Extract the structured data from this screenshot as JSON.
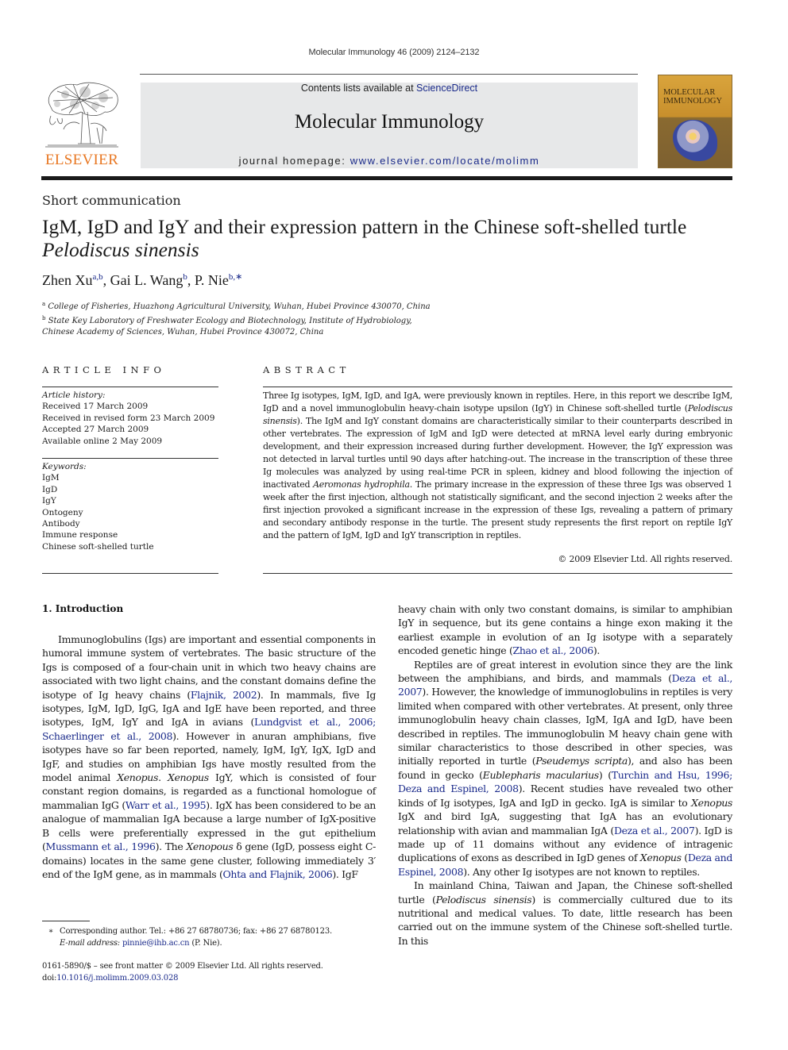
{
  "running_head": "Molecular Immunology 46 (2009) 2124–2132",
  "masthead": {
    "contents_prefix": "Contents lists available at ",
    "contents_link": "ScienceDirect",
    "journal_name": "Molecular Immunology",
    "homepage_prefix": "journal homepage: ",
    "homepage_link": "www.elsevier.com/locate/molimm",
    "publisher_logo_text": "ELSEVIER",
    "cover_title_line1": "MOLECULAR",
    "cover_title_line2": "IMMUNOLOGY",
    "colors": {
      "publisher_orange": "#e87722",
      "link_blue": "#1a2a8a",
      "masthead_bg": "#e7e8e9"
    }
  },
  "article": {
    "type": "Short communication",
    "title_main": "IgM, IgD and IgY and their expression pattern in the Chinese soft-shelled turtle",
    "title_species": "Pelodiscus sinensis",
    "authors": [
      {
        "name": "Zhen Xu",
        "sup": "a,b",
        "sep": ", "
      },
      {
        "name": "Gai L. Wang",
        "sup": "b",
        "sep": ", "
      },
      {
        "name": "P. Nie",
        "sup": "b,∗",
        "sep": ""
      }
    ],
    "affiliations": [
      {
        "mark": "a",
        "text": "College of Fisheries, Huazhong Agricultural University, Wuhan, Hubei Province 430070, China"
      },
      {
        "mark": "b",
        "text": "State Key Laboratory of Freshwater Ecology and Biotechnology, Institute of Hydrobiology,",
        "cont": "Chinese Academy of Sciences, Wuhan, Hubei Province 430072, China"
      }
    ]
  },
  "article_info": {
    "heading": "ARTICLE INFO",
    "history_label": "Article history:",
    "history": [
      "Received 17 March 2009",
      "Received in revised form 23 March 2009",
      "Accepted 27 March 2009",
      "Available online 2 May 2009"
    ],
    "keywords_label": "Keywords:",
    "keywords": [
      "IgM",
      "IgD",
      "IgY",
      "Ontogeny",
      "Antibody",
      "Immune response",
      "Chinese soft-shelled turtle"
    ]
  },
  "abstract": {
    "heading": "ABSTRACT",
    "p1": "Three Ig isotypes, IgM, IgD, and IgA, were previously known in reptiles. Here, in this report we describe IgM, IgD and a novel immunoglobulin heavy-chain isotype upsilon (IgY) in Chinese soft-shelled turtle (",
    "p1_species": "Pelodiscus sinensis",
    "p2": "). The IgM and IgY constant domains are characteristically similar to their counterparts described in other vertebrates. The expression of IgM and IgD were detected at mRNA level early during embryonic development, and their expression increased during further development. However, the IgY expression was not detected in larval turtles until 90 days after hatching-out. The increase in the transcription of these three Ig molecules was analyzed by using real-time PCR in spleen, kidney and blood following the injection of inactivated ",
    "p2_species": "Aeromonas hydrophila",
    "p3": ". The primary increase in the expression of these three Igs was observed 1 week after the first injection, although not statistically significant, and the second injection 2 weeks after the first injection provoked a significant increase in the expression of these Igs, revealing a pattern of primary and secondary antibody response in the turtle. The present study represents the first report on reptile IgY and the pattern of IgM, IgD and IgY transcription in reptiles.",
    "copyright": "© 2009 Elsevier Ltd. All rights reserved."
  },
  "intro": {
    "heading": "1.  Introduction",
    "left": {
      "t1": "Immunoglobulins (Igs) are important and essential components in humoral immune system of vertebrates. The basic structure of the Igs is composed of a four-chain unit in which two heavy chains are associated with two light chains, and the constant domains define the isotype of Ig heavy chains (",
      "r1": "Flajnik, 2002",
      "t2": "). In mammals, five Ig isotypes, IgM, IgD, IgG, IgA and IgE have been reported, and three isotypes, IgM, IgY and IgA in avians (",
      "r2": "Lundgvist et al., 2006; Schaerlinger et al., 2008",
      "t3": "). However in anuran amphibians, five isotypes have so far been reported, namely, IgM, IgY, IgX, IgD and IgF, and studies on amphibian Igs have mostly resulted from the model animal ",
      "i1": "Xenopus",
      "t4": ". ",
      "i2": "Xenopus",
      "t5": " IgY, which is consisted of four constant region domains, is regarded as a functional homologue of mammalian IgG (",
      "r3": "Warr et al., 1995",
      "t6": "). IgX has been considered to be an analogue of mammalian IgA because a large number of IgX-positive B cells were preferentially expressed in the gut epithelium (",
      "r4": "Mussmann et al., 1996",
      "t7": "). The ",
      "i3": "Xenopous",
      "t8": " δ gene (IgD, possess eight C-domains) locates in the same gene cluster, following immediately 3′ end of the IgM gene, as in mammals (",
      "r5": "Ohta and Flajnik, 2006",
      "t9": "). IgF"
    },
    "right": {
      "a1": "heavy chain with only two constant domains, is similar to amphibian IgY in sequence, but its gene contains a hinge exon making it the earliest example in evolution of an Ig isotype with a separately encoded genetic hinge (",
      "ar1": "Zhao et al., 2006",
      "a2": ").",
      "b1": "Reptiles are of great interest in evolution since they are the link between the amphibians, and birds, and mammals (",
      "br1": "Deza et al., 2007",
      "b2": "). However, the knowledge of immunoglobulins in reptiles is very limited when compared with other vertebrates. At present, only three immunoglobulin heavy chain classes, IgM, IgA and IgD, have been described in reptiles. The immunoglobulin M heavy chain gene with similar characteristics to those described in other species, was initially reported in turtle (",
      "bi1": "Pseudemys scripta",
      "b3": "), and also has been found in gecko (",
      "bi2": "Eublepharis macularius",
      "b4": ") (",
      "br2": "Turchin and Hsu, 1996; Deza and Espinel, 2008",
      "b5": "). Recent studies have revealed two other kinds of Ig isotypes, IgA and IgD in gecko. IgA is similar to ",
      "bi3": "Xenopus",
      "b6": " IgX and bird IgA, suggesting that IgA has an evolutionary relationship with avian and mammalian IgA (",
      "br3": "Deza et al., 2007",
      "b7": "). IgD is made up of 11 domains without any evidence of intragenic duplications of exons as described in IgD genes of ",
      "bi4": "Xenopus",
      "b8": " (",
      "br4": "Deza and Espinel, 2008",
      "b9": "). Any other Ig isotypes are not known to reptiles.",
      "c1": "In mainland China, Taiwan and Japan, the Chinese soft-shelled turtle (",
      "ci1": "Pelodiscus sinensis",
      "c2": ") is commercially cultured due to its nutritional and medical values. To date, little research has been carried out on the immune system of the Chinese soft-shelled turtle. In this"
    }
  },
  "footnote": {
    "star": "∗",
    "text": "Corresponding author. Tel.: +86 27 68780736; fax: +86 27 68780123.",
    "email_label": "E-mail address:",
    "email": "pinnie@ihb.ac.cn",
    "email_suffix": " (P. Nie)."
  },
  "front_matter": {
    "issn_line": "0161-5890/$ – see front matter © 2009 Elsevier Ltd. All rights reserved.",
    "doi_prefix": "doi:",
    "doi": "10.1016/j.molimm.2009.03.028"
  }
}
